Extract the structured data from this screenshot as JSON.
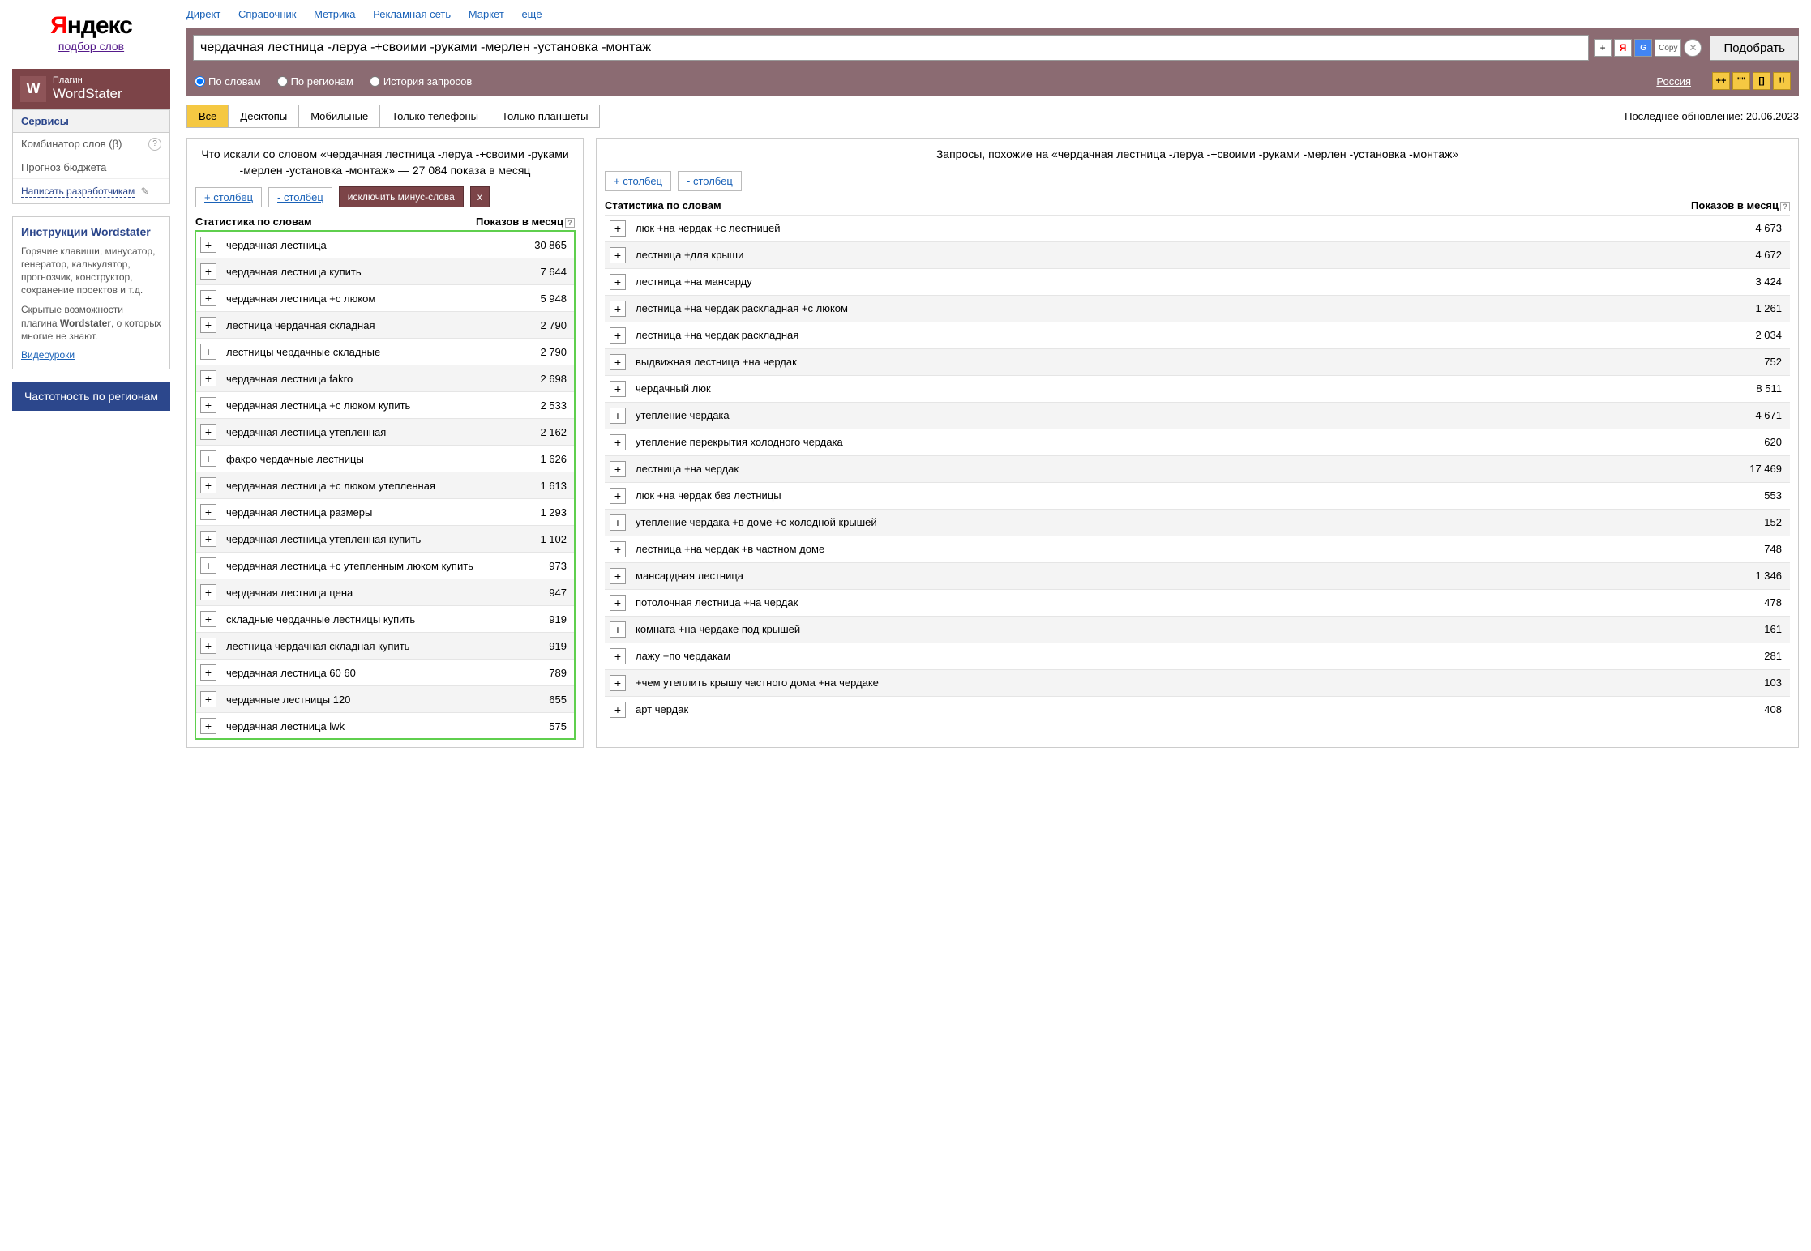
{
  "logo": {
    "brand": "Яндекс",
    "subtitle": "подбор слов"
  },
  "plugin": {
    "label": "Плагин",
    "name": "WordStater",
    "icon": "W"
  },
  "sidebar": {
    "services_head": "Сервисы",
    "items": [
      "Комбинатор слов (β)",
      "Прогноз бюджета"
    ],
    "dev_link": "Написать разработчикам",
    "info_head": "Инструкции Wordstater",
    "info_p1": "Горячие клавиши, минусатор, генератор, калькулятор, прогнозчик, конструктор, сохранение проектов и т.д.",
    "info_p2_a": "Скрытые возможности плагина ",
    "info_p2_b": "Wordstater",
    "info_p2_c": ", о которых многие не знают.",
    "video_link": "Видеоуроки",
    "region_btn": "Частотность по регионам"
  },
  "topnav": [
    "Директ",
    "Справочник",
    "Метрика",
    "Рекламная сеть",
    "Маркет",
    "ещё"
  ],
  "search": {
    "value": "чердачная лестница -леруа -+своими -руками -мерлен -установка -монтаж",
    "submit": "Подобрать",
    "copy": "Copy",
    "radios": [
      "По словам",
      "По регионам",
      "История запросов"
    ],
    "region": "Россия",
    "yb": [
      "++",
      "\"\"",
      "[]",
      "!!"
    ]
  },
  "tabs": [
    "Все",
    "Десктопы",
    "Мобильные",
    "Только телефоны",
    "Только планшеты"
  ],
  "update": "Последнее обновление: 20.06.2023",
  "left": {
    "title": "Что искали со словом «чердачная лестница -леруа -+своими -руками -мерлен -установка -монтаж» — 27 084 показа в месяц",
    "add_col": "+ столбец",
    "del_col": "- столбец",
    "exclude": "исключить минус-слова",
    "x": "х",
    "th1": "Статистика по словам",
    "th2": "Показов в месяц",
    "rows": [
      {
        "t": "чердачная лестница",
        "n": "30 865"
      },
      {
        "t": "чердачная лестница купить",
        "n": "7 644"
      },
      {
        "t": "чердачная лестница +с люком",
        "n": "5 948"
      },
      {
        "t": "лестница чердачная складная",
        "n": "2 790"
      },
      {
        "t": "лестницы чердачные складные",
        "n": "2 790"
      },
      {
        "t": "чердачная лестница fakro",
        "n": "2 698"
      },
      {
        "t": "чердачная лестница +с люком купить",
        "n": "2 533"
      },
      {
        "t": "чердачная лестница утепленная",
        "n": "2 162"
      },
      {
        "t": "факро чердачные лестницы",
        "n": "1 626"
      },
      {
        "t": "чердачная лестница +с люком утепленная",
        "n": "1 613"
      },
      {
        "t": "чердачная лестница размеры",
        "n": "1 293"
      },
      {
        "t": "чердачная лестница утепленная купить",
        "n": "1 102"
      },
      {
        "t": "чердачная лестница +с утепленным люком купить",
        "n": "973"
      },
      {
        "t": "чердачная лестница цена",
        "n": "947"
      },
      {
        "t": "складные чердачные лестницы купить",
        "n": "919"
      },
      {
        "t": "лестница чердачная складная купить",
        "n": "919"
      },
      {
        "t": "чердачная лестница 60 60",
        "n": "789"
      },
      {
        "t": "чердачные лестницы 120",
        "n": "655"
      },
      {
        "t": "чердачная лестница lwk",
        "n": "575"
      }
    ]
  },
  "right": {
    "title": "Запросы, похожие на «чердачная лестница -леруа -+своими -руками -мерлен -установка -монтаж»",
    "add_col": "+ столбец",
    "del_col": "- столбец",
    "th1": "Статистика по словам",
    "th2": "Показов в месяц",
    "rows": [
      {
        "t": "люк +на чердак +с лестницей",
        "n": "4 673"
      },
      {
        "t": "лестница +для крыши",
        "n": "4 672"
      },
      {
        "t": "лестница +на мансарду",
        "n": "3 424"
      },
      {
        "t": "лестница +на чердак раскладная +с люком",
        "n": "1 261"
      },
      {
        "t": "лестница +на чердак раскладная",
        "n": "2 034"
      },
      {
        "t": "выдвижная лестница +на чердак",
        "n": "752"
      },
      {
        "t": "чердачный люк",
        "n": "8 511"
      },
      {
        "t": "утепление чердака",
        "n": "4 671"
      },
      {
        "t": "утепление перекрытия холодного чердака",
        "n": "620"
      },
      {
        "t": "лестница +на чердак",
        "n": "17 469"
      },
      {
        "t": "люк +на чердак без лестницы",
        "n": "553"
      },
      {
        "t": "утепление чердака +в доме +с холодной крышей",
        "n": "152"
      },
      {
        "t": "лестница +на чердак +в частном доме",
        "n": "748"
      },
      {
        "t": "мансардная лестница",
        "n": "1 346"
      },
      {
        "t": "потолочная лестница +на чердак",
        "n": "478"
      },
      {
        "t": "комната +на чердаке под крышей",
        "n": "161"
      },
      {
        "t": "лажу +по чердакам",
        "n": "281"
      },
      {
        "t": "+чем утеплить крышу частного дома +на чердаке",
        "n": "103"
      },
      {
        "t": "арт чердак",
        "n": "408"
      }
    ]
  }
}
